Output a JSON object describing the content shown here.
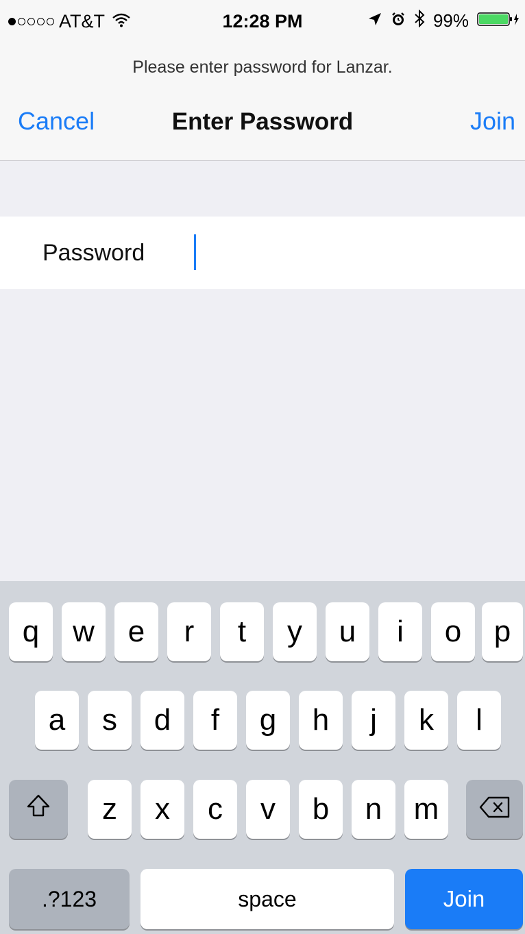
{
  "status_bar": {
    "carrier": "AT&T",
    "time": "12:28 PM",
    "battery_percent": "99%",
    "signal_bars_filled": 1,
    "signal_bars_total": 5
  },
  "header": {
    "prompt": "Please enter password for Lanzar.",
    "title": "Enter Password",
    "cancel_label": "Cancel",
    "join_label": "Join"
  },
  "password_field": {
    "label": "Password",
    "value": ""
  },
  "keyboard": {
    "row1": [
      "q",
      "w",
      "e",
      "r",
      "t",
      "y",
      "u",
      "i",
      "o",
      "p"
    ],
    "row2": [
      "a",
      "s",
      "d",
      "f",
      "g",
      "h",
      "j",
      "k",
      "l"
    ],
    "row3": [
      "z",
      "x",
      "c",
      "v",
      "b",
      "n",
      "m"
    ],
    "numbers_label": ".?123",
    "space_label": "space",
    "join_label": "Join"
  },
  "colors": {
    "accent": "#1a7cf7",
    "battery": "#4cd964",
    "keyboard_bg": "#d1d5db"
  },
  "icons": {
    "wifi": "wifi-icon",
    "location": "location-arrow-icon",
    "alarm": "alarm-icon",
    "bluetooth": "bluetooth-icon",
    "battery": "battery-icon",
    "shift": "shift-icon",
    "backspace": "backspace-icon"
  }
}
